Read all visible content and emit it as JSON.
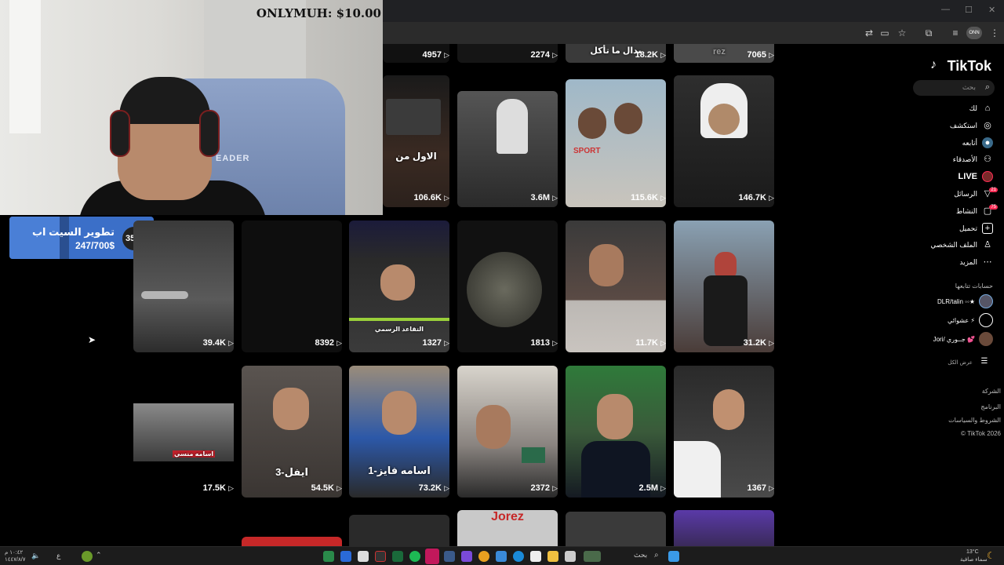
{
  "webcam": {
    "overlay_text": "ONLYMUH: $10.00",
    "chair_brand": "EADER"
  },
  "goal": {
    "title": "تطوير السيت اب",
    "progress": "247/700$",
    "percent": "35%",
    "fill_fraction": 0.35
  },
  "browser": {
    "tab_controls": [
      "—",
      "☐",
      "✕"
    ],
    "profile_label": "ONN"
  },
  "tiktok": {
    "logo": "TikTok",
    "search_placeholder": "بحث",
    "nav": [
      {
        "label": "لك",
        "icon": "home-icon"
      },
      {
        "label": "استكشف",
        "icon": "explore-icon"
      },
      {
        "label": "أتابعه",
        "icon": "following-icon"
      },
      {
        "label": "الأصدقاء",
        "icon": "friends-icon"
      },
      {
        "label": "LIVE",
        "icon": "live-icon"
      },
      {
        "label": "الرسائل",
        "icon": "messages-icon",
        "badge": "21"
      },
      {
        "label": "النشاط",
        "icon": "activity-icon",
        "badge": "75"
      },
      {
        "label": "تحميل",
        "icon": "upload-icon"
      },
      {
        "label": "الملف الشخصي",
        "icon": "profile-icon"
      },
      {
        "label": "المزيد",
        "icon": "more-icon"
      }
    ],
    "following_title": "حسابات تتابعها",
    "following": [
      {
        "name": "DLR/talin ◦◦★"
      },
      {
        "name": "عشوائي ⚡"
      },
      {
        "name": "Jori/ جــوري 💕"
      }
    ],
    "show_all": "عرض الكل",
    "footer": [
      "الشركة",
      "البرنامج",
      "الشروط والسياسات",
      "TikTok 2026 ©"
    ]
  },
  "grid": {
    "top_row": [
      "4957",
      "2274",
      "18.2K",
      "7065"
    ],
    "top_row_captions": [
      "",
      "",
      "بدال ما تأكل",
      "rez"
    ],
    "row1": [
      {
        "count": "106.6K",
        "caption": "الاول من"
      },
      {
        "count": "3.6M",
        "caption": ""
      },
      {
        "count": "115.6K",
        "caption": "SPORT"
      },
      {
        "count": "146.7K",
        "caption": ""
      }
    ],
    "row2": [
      {
        "count": "39.4K",
        "caption": ""
      },
      {
        "count": "8392",
        "caption": ""
      },
      {
        "count": "1327",
        "caption": "التقاعد الرسمي"
      },
      {
        "count": "1813",
        "caption": ""
      },
      {
        "count": "11.7K",
        "caption": ""
      },
      {
        "count": "31.2K",
        "caption": ""
      }
    ],
    "row3": [
      {
        "count": "17.5K",
        "caption": "اسامه منسي"
      },
      {
        "count": "54.5K",
        "caption": "3-ايفل"
      },
      {
        "count": "73.2K",
        "caption": "1-اسامه فايز"
      },
      {
        "count": "2372",
        "caption": ""
      },
      {
        "count": "2.5M",
        "caption": ""
      },
      {
        "count": "1367",
        "caption": ""
      }
    ],
    "bottom_caption": "Jorez"
  },
  "taskbar": {
    "search_label": "بحث",
    "weather": "13°C",
    "weather_desc": "سماء صافية",
    "time": "١٠:٤٢ م",
    "date": "١٤٤٧/٨/٧"
  }
}
